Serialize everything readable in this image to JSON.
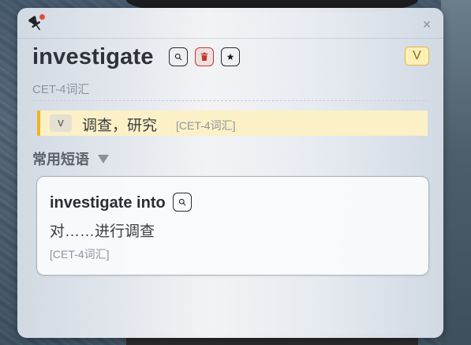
{
  "window": {
    "close_symbol": "×"
  },
  "entry": {
    "word": "investigate",
    "pos_badge": "V",
    "source": "CET-4词汇"
  },
  "definitions": [
    {
      "pos": "v",
      "text": "调查，研究",
      "source": "[CET-4词汇]"
    }
  ],
  "phrases_section": {
    "title": "常用短语",
    "items": [
      {
        "phrase": "investigate into",
        "meaning": "对……进行调查",
        "source": "[CET-4词汇]"
      }
    ]
  },
  "icons": {
    "pin": "pin-icon",
    "close": "close-icon",
    "search": "search-icon",
    "delete": "trash-icon",
    "favorite": "star-icon",
    "collapse": "caret-down-icon"
  },
  "colors": {
    "accent_yellow": "#f0b51a",
    "definition_bg": "#fcf0c7",
    "delete_red": "#c0392b",
    "pin_dot": "#e34b3a"
  }
}
